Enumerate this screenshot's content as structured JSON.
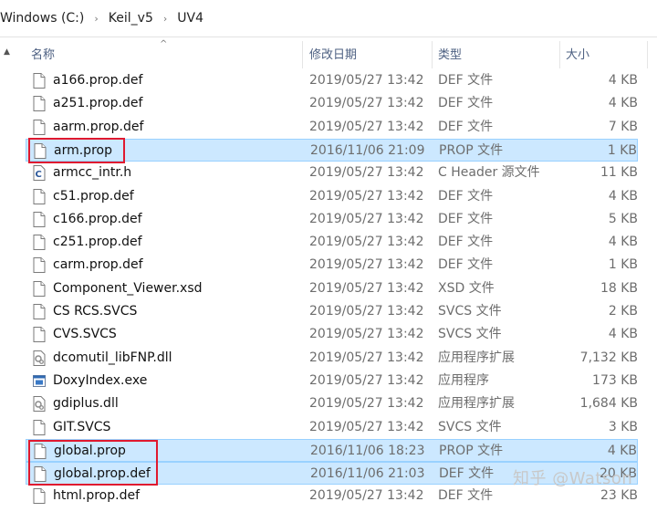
{
  "breadcrumb": {
    "segments": [
      "Windows (C:)",
      "Keil_v5",
      "UV4"
    ],
    "separator": "›"
  },
  "columns": {
    "name": "名称",
    "date": "修改日期",
    "type": "类型",
    "size": "大小"
  },
  "files": [
    {
      "name": "a166.prop.def",
      "date": "2019/05/27 13:42",
      "type": "DEF 文件",
      "size": "4 KB",
      "icon": "file-icon"
    },
    {
      "name": "a251.prop.def",
      "date": "2019/05/27 13:42",
      "type": "DEF 文件",
      "size": "4 KB",
      "icon": "file-icon"
    },
    {
      "name": "aarm.prop.def",
      "date": "2019/05/27 13:42",
      "type": "DEF 文件",
      "size": "7 KB",
      "icon": "file-icon"
    },
    {
      "name": "arm.prop",
      "date": "2016/11/06 21:09",
      "type": "PROP 文件",
      "size": "1 KB",
      "icon": "file-icon",
      "selected": true
    },
    {
      "name": "armcc_intr.h",
      "date": "2019/05/27 13:42",
      "type": "C Header 源文件",
      "size": "11 KB",
      "icon": "c-header-icon"
    },
    {
      "name": "c51.prop.def",
      "date": "2019/05/27 13:42",
      "type": "DEF 文件",
      "size": "4 KB",
      "icon": "file-icon"
    },
    {
      "name": "c166.prop.def",
      "date": "2019/05/27 13:42",
      "type": "DEF 文件",
      "size": "5 KB",
      "icon": "file-icon"
    },
    {
      "name": "c251.prop.def",
      "date": "2019/05/27 13:42",
      "type": "DEF 文件",
      "size": "4 KB",
      "icon": "file-icon"
    },
    {
      "name": "carm.prop.def",
      "date": "2019/05/27 13:42",
      "type": "DEF 文件",
      "size": "1 KB",
      "icon": "file-icon"
    },
    {
      "name": "Component_Viewer.xsd",
      "date": "2019/05/27 13:42",
      "type": "XSD 文件",
      "size": "18 KB",
      "icon": "file-icon"
    },
    {
      "name": "CS RCS.SVCS",
      "date": "2019/05/27 13:42",
      "type": "SVCS 文件",
      "size": "2 KB",
      "icon": "file-icon"
    },
    {
      "name": "CVS.SVCS",
      "date": "2019/05/27 13:42",
      "type": "SVCS 文件",
      "size": "4 KB",
      "icon": "file-icon"
    },
    {
      "name": "dcomutil_libFNP.dll",
      "date": "2019/05/27 13:42",
      "type": "应用程序扩展",
      "size": "7,132 KB",
      "icon": "dll-icon"
    },
    {
      "name": "DoxyIndex.exe",
      "date": "2019/05/27 13:42",
      "type": "应用程序",
      "size": "173 KB",
      "icon": "exe-icon"
    },
    {
      "name": "gdiplus.dll",
      "date": "2019/05/27 13:42",
      "type": "应用程序扩展",
      "size": "1,684 KB",
      "icon": "dll-icon"
    },
    {
      "name": "GIT.SVCS",
      "date": "2019/05/27 13:42",
      "type": "SVCS 文件",
      "size": "3 KB",
      "icon": "file-icon"
    },
    {
      "name": "global.prop",
      "date": "2016/11/06 18:23",
      "type": "PROP 文件",
      "size": "4 KB",
      "icon": "file-icon",
      "selected": true
    },
    {
      "name": "global.prop.def",
      "date": "2016/11/06 21:03",
      "type": "DEF 文件",
      "size": "20 KB",
      "icon": "file-icon",
      "selected": true
    },
    {
      "name": "html.prop.def",
      "date": "2019/05/27 13:42",
      "type": "DEF 文件",
      "size": "23 KB",
      "icon": "file-icon"
    }
  ],
  "watermark": "知乎 @Watson",
  "colors": {
    "selection_bg": "#cce8ff",
    "selection_border": "#99d1ff",
    "highlight_box": "#e0192f",
    "header_text": "#4d6082"
  }
}
